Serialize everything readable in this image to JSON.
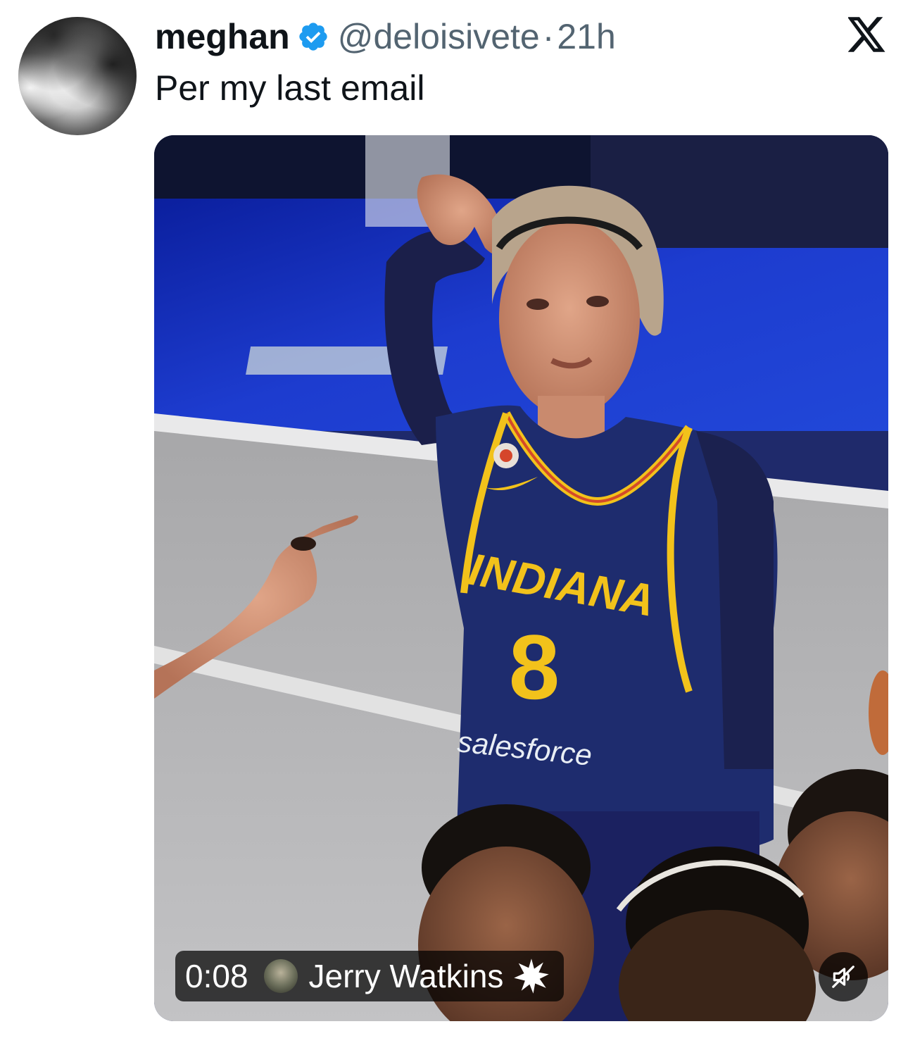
{
  "tweet": {
    "display_name": "meghan",
    "verified": true,
    "handle": "@deloisivete",
    "separator": "·",
    "time_ago": "21h",
    "text": "Per my last email"
  },
  "video": {
    "timer": "0:08",
    "creator_name": "Jerry Watkins",
    "muted": true
  },
  "jersey": {
    "team": "INDIANA",
    "number": "8",
    "sponsor": "salesforce"
  },
  "colors": {
    "verified_blue": "#1d9bf0",
    "secondary_text": "#536471",
    "primary_text": "#0f1419",
    "jersey_navy": "#1e2c6e",
    "jersey_gold": "#f2c21b",
    "court_blue": "#1d3ccf"
  },
  "icons": {
    "verified": "verified-badge-icon",
    "platform": "x-logo-icon",
    "mute": "speaker-muted-icon",
    "creator_badge": "burst-badge-icon"
  }
}
